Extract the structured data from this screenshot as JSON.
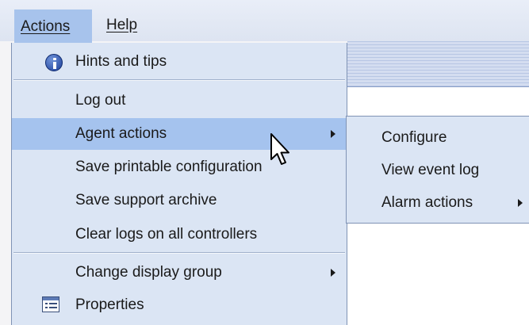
{
  "menubar": {
    "items": [
      {
        "label": "Actions"
      },
      {
        "label": "Help"
      }
    ]
  },
  "actions_menu": {
    "items": [
      {
        "label": "Hints and tips",
        "icon": "info-icon"
      },
      {
        "label": "Log out"
      },
      {
        "label": "Agent actions",
        "has_submenu": true,
        "selected": true
      },
      {
        "label": "Save printable configuration"
      },
      {
        "label": "Save support archive"
      },
      {
        "label": "Clear logs on all controllers"
      },
      {
        "label": "Change display group",
        "has_submenu": true
      },
      {
        "label": "Properties",
        "icon": "properties-icon"
      }
    ]
  },
  "agent_actions_submenu": {
    "items": [
      {
        "label": "Configure"
      },
      {
        "label": "View event log"
      },
      {
        "label": "Alarm actions",
        "has_submenu": true
      }
    ]
  },
  "colors": {
    "menu_background": "#dbe5f4",
    "selection": "#a5c3ee",
    "menubar_open": "#a7c3ec"
  }
}
